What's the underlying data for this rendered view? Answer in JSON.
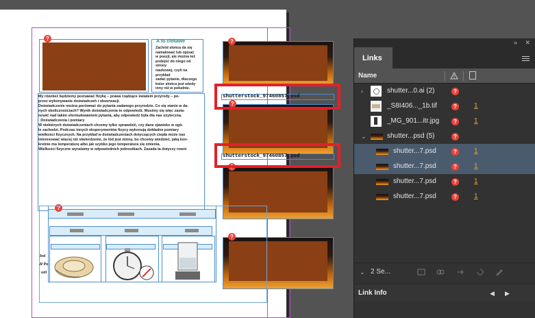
{
  "document": {
    "aside_title": "A to ciekawe",
    "aside_lines": [
      "Zachód słońca da się",
      "namalować lub opisać",
      "w poezji, ale można też",
      "podejść do niego od strony",
      "naukowej, czyli na przykład",
      "zadać pytanie, dlaczego",
      "kolor słońca jest wtedy",
      "inny niż w południe."
    ],
    "body_lines": [
      "My również będziemy poznawać fizykę – prawa rządzące światem przyrody – po-",
      "",
      "przez wykonywanie doświadczeń i obserwacji.",
      "Doświadczenie można porównać do pytania zadanego przyrodzie. Co się stanie w da-",
      "nych okolicznościach? Wynik doświadczenia to odpowiedź. Musimy się więc zasta-",
      "nowić nad takim sformułowaniem pytania, aby odpowiedź była dla nas użyteczna.",
      "",
      "· Doświadczenia i pomiary",
      "",
      "W niektórych doświadczeniach chcemy tylko sprawdzić, czy dane zjawisko w ogó-",
      "",
      "le zachodzi. Podczas innych eksperymentów fizycy wykonują dokładne pomiary",
      "",
      "wielkości fizycznych. Na przykład w doświadczeniach dotyczących ciepła może nas",
      "",
      "interesować więcej niż stwierdzenie, że lód jest zimny, bo chcemy wiedzieć, jaką kon-",
      "",
      "kretnie  ma temperaturę albo jak szybko jego temperatura się zmienia.",
      "",
      "Wielkości fizyczne wyrażamy w odpowiednich jednostkach. Zasada ta dotyczy rowni"
    ],
    "caption_1": "shutterstock_97460857.psd",
    "caption_2": "shutterstock_97460857.psd",
    "side_letters": [
      "Jed",
      "W Po",
      "i odl"
    ],
    "missing_marker": "?"
  },
  "panel": {
    "tab_label": "Links",
    "collapse_icon": "»",
    "close_icon": "✕",
    "column_name": "Name",
    "rows": [
      {
        "chevron": "›",
        "name": "shutter...0.ai (2)",
        "page": ""
      },
      {
        "chevron": "",
        "name": "_S8I406..._1b.tif",
        "page": "1"
      },
      {
        "chevron": "",
        "name": "_MG_901...itr.jpg",
        "page": "1"
      },
      {
        "chevron": "⌄",
        "name": "shutter...psd (5)",
        "page": ""
      },
      {
        "chevron": "",
        "name": "shutter...7.psd",
        "page": "1"
      },
      {
        "chevron": "",
        "name": "shutter...7.psd",
        "page": "1"
      },
      {
        "chevron": "",
        "name": "shutter...7.psd",
        "page": "1"
      },
      {
        "chevron": "",
        "name": "shutter...7.psd",
        "page": "1"
      }
    ],
    "footer_chevron": "⌄",
    "footer_label": "2 Se...",
    "link_info_label": "Link Info",
    "prev_arrow": "◀",
    "next_arrow": "▶"
  },
  "colors": {
    "missing_link": "#e8443b",
    "selected_row": "#4a5b6e",
    "page_number": "#e8a62e",
    "highlight_box": "#e2202a"
  }
}
